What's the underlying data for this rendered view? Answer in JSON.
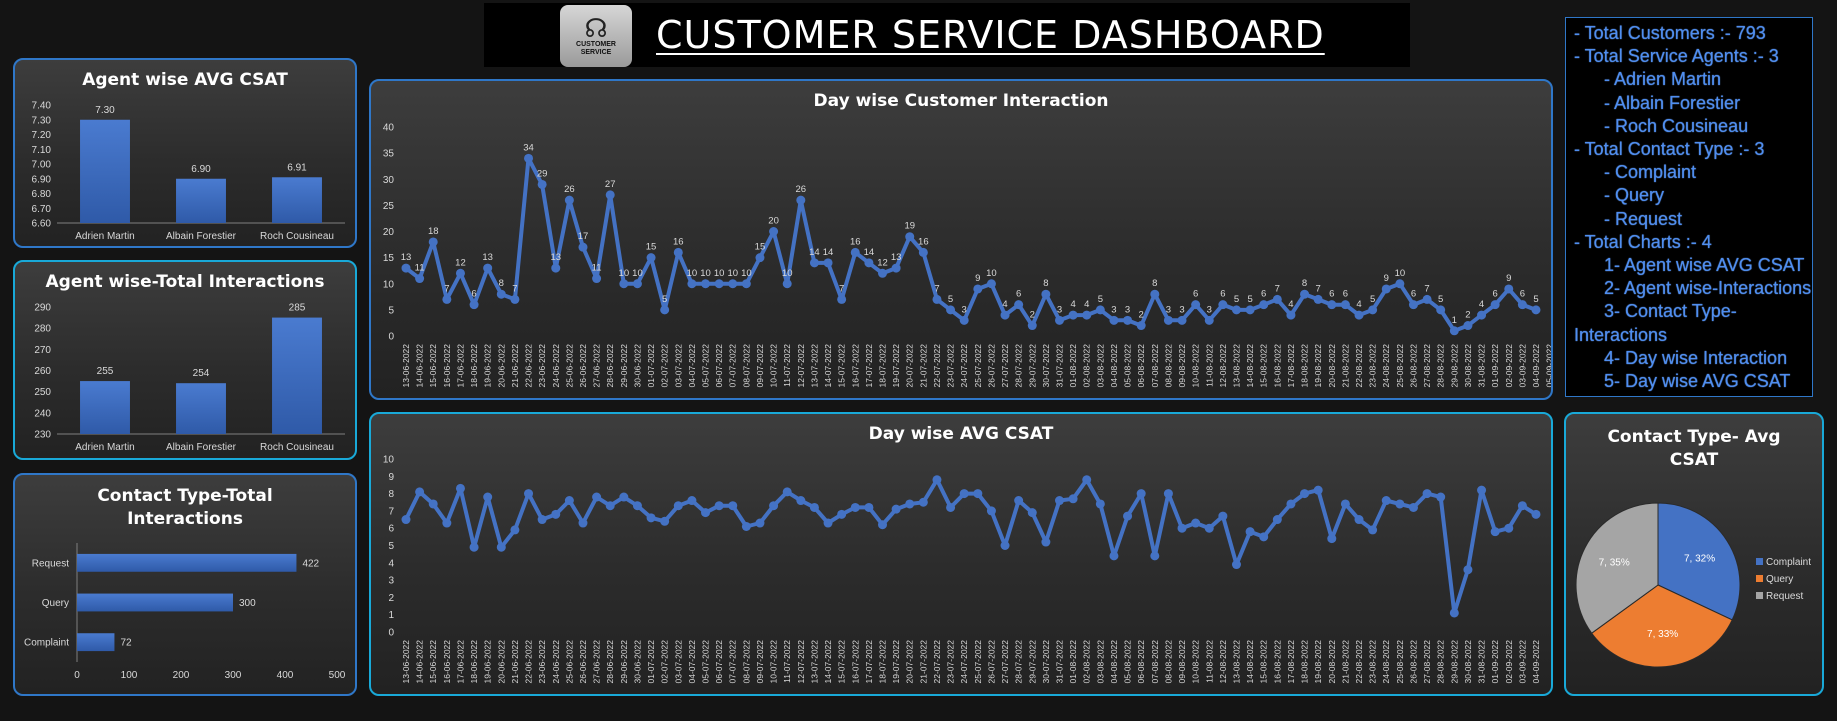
{
  "header": {
    "title": "CUSTOMER SERVICE DASHBOARD",
    "logo_text": "CUSTOMER SERVICE"
  },
  "colors": {
    "accent": "#4472C4",
    "panel_border": "#2f77c8",
    "orange": "#ED7D31",
    "gray": "#A5A5A5",
    "info_text": "#4f8ef0"
  },
  "info_lines": [
    "- Total Customers :- 793",
    "- Total Service Agents :- 3",
    "      - Adrien Martin",
    "      - Albain Forestier",
    "      - Roch Cousineau",
    "- Total Contact Type :- 3",
    "      - Complaint",
    "      - Query",
    "      - Request",
    "- Total Charts :- 4",
    "      1- Agent wise AVG CSAT",
    "      2- Agent wise-Interactions",
    "      3- Contact Type-",
    "Interactions",
    "      4- Day wise Interaction",
    "      5- Day wise AVG CSAT"
  ],
  "chart_data": [
    {
      "id": "agent_csat",
      "type": "bar",
      "title": "Agent wise AVG CSAT",
      "categories": [
        "Adrien Martin",
        "Albain Forestier",
        "Roch Cousineau"
      ],
      "values": [
        7.3,
        6.9,
        6.91
      ],
      "labels": [
        "7.30",
        "6.90",
        "6.91"
      ],
      "ylim": [
        6.6,
        7.4
      ],
      "yticks": [
        "6.60",
        "6.70",
        "6.80",
        "6.90",
        "7.00",
        "7.10",
        "7.20",
        "7.30",
        "7.40"
      ]
    },
    {
      "id": "agent_interactions",
      "type": "bar",
      "title": "Agent wise-Total Interactions",
      "categories": [
        "Adrien Martin",
        "Albain Forestier",
        "Roch Cousineau"
      ],
      "values": [
        255,
        254,
        285
      ],
      "labels": [
        "255",
        "254",
        "285"
      ],
      "ylim": [
        230,
        290
      ],
      "yticks": [
        "230",
        "240",
        "250",
        "260",
        "270",
        "280",
        "290"
      ]
    },
    {
      "id": "contact_interactions",
      "type": "bar",
      "orientation": "horizontal",
      "title": "Contact Type-Total Interactions",
      "categories": [
        "Request",
        "Query",
        "Complaint"
      ],
      "values": [
        422,
        300,
        72
      ],
      "labels": [
        "422",
        "300",
        "72"
      ],
      "xlim": [
        0,
        500
      ],
      "xticks": [
        "0",
        "100",
        "200",
        "300",
        "400",
        "500"
      ]
    },
    {
      "id": "day_interaction",
      "type": "line",
      "title": "Day wise Customer Interaction",
      "ylim": [
        0,
        40
      ],
      "yticks": [
        "0",
        "5",
        "10",
        "15",
        "20",
        "25",
        "30",
        "35",
        "40"
      ],
      "x": [
        "13-06-2022",
        "14-06-2022",
        "15-06-2022",
        "16-06-2022",
        "17-06-2022",
        "18-06-2022",
        "19-06-2022",
        "20-06-2022",
        "21-06-2022",
        "22-06-2022",
        "23-06-2022",
        "24-06-2022",
        "25-06-2022",
        "26-06-2022",
        "27-06-2022",
        "28-06-2022",
        "29-06-2022",
        "30-06-2022",
        "01-07-2022",
        "02-07-2022",
        "03-07-2022",
        "04-07-2022",
        "05-07-2022",
        "06-07-2022",
        "07-07-2022",
        "08-07-2022",
        "09-07-2022",
        "10-07-2022",
        "11-07-2022",
        "12-07-2022",
        "13-07-2022",
        "14-07-2022",
        "15-07-2022",
        "16-07-2022",
        "17-07-2022",
        "18-07-2022",
        "19-07-2022",
        "20-07-2022",
        "21-07-2022",
        "22-07-2022",
        "23-07-2022",
        "24-07-2022",
        "25-07-2022",
        "26-07-2022",
        "27-07-2022",
        "28-07-2022",
        "29-07-2022",
        "30-07-2022",
        "31-07-2022",
        "01-08-2022",
        "02-08-2022",
        "03-08-2022",
        "04-08-2022",
        "05-08-2022",
        "06-08-2022",
        "07-08-2022",
        "08-08-2022",
        "09-08-2022",
        "10-08-2022",
        "11-08-2022",
        "12-08-2022",
        "13-08-2022",
        "14-08-2022",
        "15-08-2022",
        "16-08-2022",
        "17-08-2022",
        "18-08-2022",
        "19-08-2022",
        "20-08-2022",
        "21-08-2022",
        "22-08-2022",
        "23-08-2022",
        "24-08-2022",
        "25-08-2022",
        "26-08-2022",
        "27-08-2022",
        "28-08-2022",
        "29-08-2022",
        "30-08-2022",
        "31-08-2022",
        "01-09-2022",
        "02-09-2022",
        "03-09-2022",
        "04-09-2022",
        "05-09-2022",
        "06-09-2022"
      ],
      "values": [
        13,
        11,
        18,
        7,
        12,
        6,
        13,
        8,
        7,
        34,
        29,
        13,
        26,
        17,
        11,
        27,
        10,
        10,
        15,
        5,
        16,
        10,
        10,
        10,
        10,
        10,
        15,
        20,
        10,
        26,
        14,
        14,
        7,
        16,
        14,
        12,
        13,
        19,
        16,
        7,
        5,
        3,
        9,
        10,
        4,
        6,
        2,
        8,
        3,
        4,
        4,
        5,
        3,
        3,
        2,
        8,
        3,
        3,
        6,
        3,
        6,
        5,
        5,
        6,
        7,
        4,
        8,
        7,
        6,
        6,
        4,
        5,
        9,
        10,
        6,
        7,
        5,
        1,
        2,
        4,
        6,
        9,
        6,
        5
      ]
    },
    {
      "id": "day_csat",
      "type": "line",
      "title": "Day wise AVG CSAT",
      "ylim": [
        0,
        10
      ],
      "yticks": [
        "0",
        "1",
        "2",
        "3",
        "4",
        "5",
        "6",
        "7",
        "8",
        "9",
        "10"
      ],
      "values": [
        6.5,
        8.1,
        7.4,
        6.3,
        8.3,
        4.9,
        7.8,
        4.9,
        5.9,
        8.0,
        6.5,
        6.8,
        7.6,
        6.3,
        7.8,
        7.3,
        7.8,
        7.3,
        6.6,
        6.4,
        7.3,
        7.6,
        6.9,
        7.3,
        7.3,
        6.1,
        6.3,
        7.3,
        8.1,
        7.6,
        7.2,
        6.3,
        6.8,
        7.2,
        7.2,
        6.2,
        7.1,
        7.4,
        7.5,
        8.8,
        7.2,
        8.0,
        8.0,
        7.0,
        5.0,
        7.6,
        6.9,
        5.2,
        7.6,
        7.7,
        8.8,
        7.4,
        4.4,
        6.7,
        8.0,
        4.4,
        8.0,
        6.0,
        6.3,
        6.0,
        6.7,
        3.9,
        5.8,
        5.5,
        6.5,
        7.4,
        8.0,
        8.2,
        5.4,
        7.4,
        6.5,
        5.9,
        7.6,
        7.4,
        7.2,
        8.0,
        7.8,
        1.1,
        3.6,
        8.2,
        5.8,
        6.0,
        7.3,
        6.8
      ]
    },
    {
      "id": "contact_csat",
      "type": "pie",
      "title": "Contact Type- Avg CSAT",
      "categories": [
        "Complaint",
        "Query",
        "Request"
      ],
      "values": [
        32,
        33,
        35
      ],
      "labels": [
        "7, 32%",
        "7, 33%",
        "7, 35%"
      ],
      "colors": [
        "#4472C4",
        "#ED7D31",
        "#A5A5A5"
      ]
    }
  ]
}
